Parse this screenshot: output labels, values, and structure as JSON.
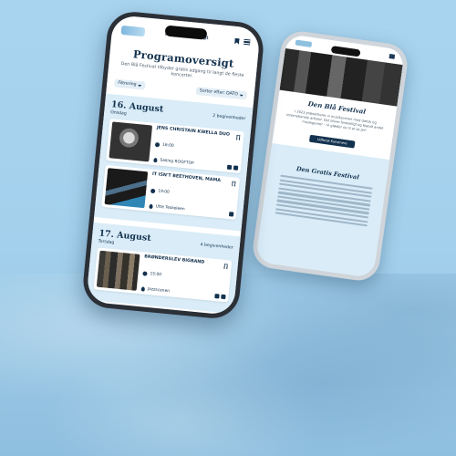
{
  "colors": {
    "navy": "#13324f",
    "sky": "#d9ecf8",
    "background": "#a9d4ef"
  },
  "back_phone": {
    "section_title": "Den Blå Festival",
    "section_text": "I 2023 præsenterer vi musikscenen med dansk og internationale artister. Det bliver forskelligt og blandt andet musikgenrer – Vi glæder os til at se jer!",
    "button_label": "Udforsk Kunstnere",
    "free_title": "Den Gratis Festival"
  },
  "front_phone": {
    "header_title": "ProgramOversigt",
    "page_title": "Programoversigt",
    "subtitle": "Den Blå Festival tilbyder gratis adgang til langt de fleste koncerter.",
    "filter_label": "Filtrering",
    "sort_label": "Sorter efter: DATO",
    "days": [
      {
        "date": "16. August",
        "count": "2 begivenheder",
        "weekday": "Onsdag",
        "events": [
          {
            "name": "JENS CHRISTAIN KWELLA DUO",
            "time": "16:00",
            "venue": "Sailing ROOFTOP"
          },
          {
            "name": "IT ISN'T BEETHOVEN, MAMA",
            "time": "19:00",
            "venue": "Utte Teskeleen"
          }
        ]
      },
      {
        "date": "17. August",
        "count": "4 begivenheder",
        "weekday": "Torsdag",
        "events": [
          {
            "name": "BRØNDERSLEV BIGBAND",
            "time": "15:00",
            "venue": "Jazzscenen"
          }
        ]
      }
    ]
  }
}
